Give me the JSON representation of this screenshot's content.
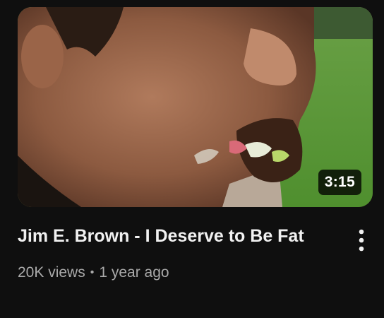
{
  "video": {
    "title": "Jim E. Brown - I Deserve to Be Fat",
    "duration": "3:15",
    "views": "20K views",
    "separator": "•",
    "age": "1 year ago"
  },
  "icons": {
    "more": "more-vert-icon"
  },
  "colors": {
    "background": "#0f0f0f",
    "title": "#f1f1f1",
    "meta": "#aaaaaa"
  }
}
